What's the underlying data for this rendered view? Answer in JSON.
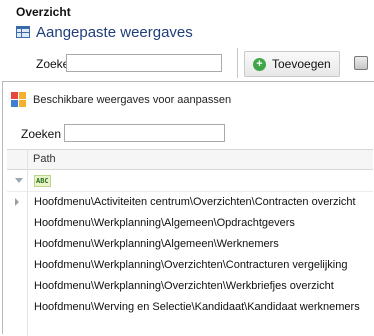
{
  "header": {
    "section_title": "Overzicht",
    "page_title": "Aangepaste weergaves",
    "page_icon": "grid-icon"
  },
  "toolbar": {
    "search_label": "Zoeken",
    "search_value": "",
    "add_label": "Toevoegen",
    "add_icon": "plus-circle-icon",
    "add_icon_color": "#3ea646",
    "extra_icon": "print-icon"
  },
  "popup": {
    "title": "Beschikbare weergaves voor aanpassen",
    "title_icon": "views-icon",
    "search_label": "Zoeken",
    "search_value": "",
    "grid": {
      "column_header": "Path",
      "filter_icon": "filter-icon",
      "filter_type_icon": "abc-icon",
      "filter_type_text": "ABC",
      "rows": [
        {
          "path": "Hoofdmenu\\Activiteiten centrum\\Overzichten\\Contracten overzicht",
          "selected": true
        },
        {
          "path": "Hoofdmenu\\Werkplanning\\Algemeen\\Opdrachtgevers"
        },
        {
          "path": "Hoofdmenu\\Werkplanning\\Algemeen\\Werknemers"
        },
        {
          "path": "Hoofdmenu\\Werkplanning\\Overzichten\\Contracturen vergelijking"
        },
        {
          "path": "Hoofdmenu\\Werkplanning\\Overzichten\\Werkbriefjes overzicht"
        },
        {
          "path": "Hoofdmenu\\Werving en Selectie\\Kandidaat\\Kandidaat werknemers"
        }
      ]
    }
  }
}
